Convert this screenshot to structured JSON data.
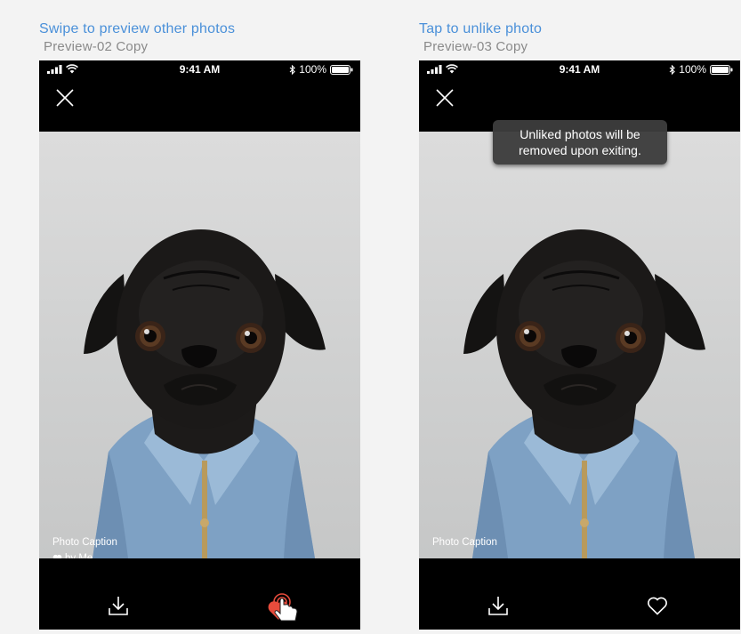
{
  "artboards": [
    {
      "title": "Swipe to preview other photos",
      "subtitle": "Preview-02 Copy",
      "status": {
        "time": "9:41 AM",
        "battery": "100%"
      },
      "caption": "Photo Caption",
      "liked_by": "by Me"
    },
    {
      "title": "Tap to unlike photo",
      "subtitle": "Preview-03 Copy",
      "status": {
        "time": "9:41 AM",
        "battery": "100%"
      },
      "caption": "Photo Caption",
      "toast": {
        "line1": "Unliked photos will be",
        "line2": "removed upon exiting."
      }
    }
  ],
  "icons": {
    "close": "close-icon",
    "download": "download-icon",
    "liked": "heart-filled-icon",
    "unliked": "heart-outline-icon",
    "tap": "tap-hand-icon"
  },
  "colors": {
    "title": "#4a90d9",
    "subtitle": "#8a8a8a",
    "like": "#e74c3c"
  }
}
